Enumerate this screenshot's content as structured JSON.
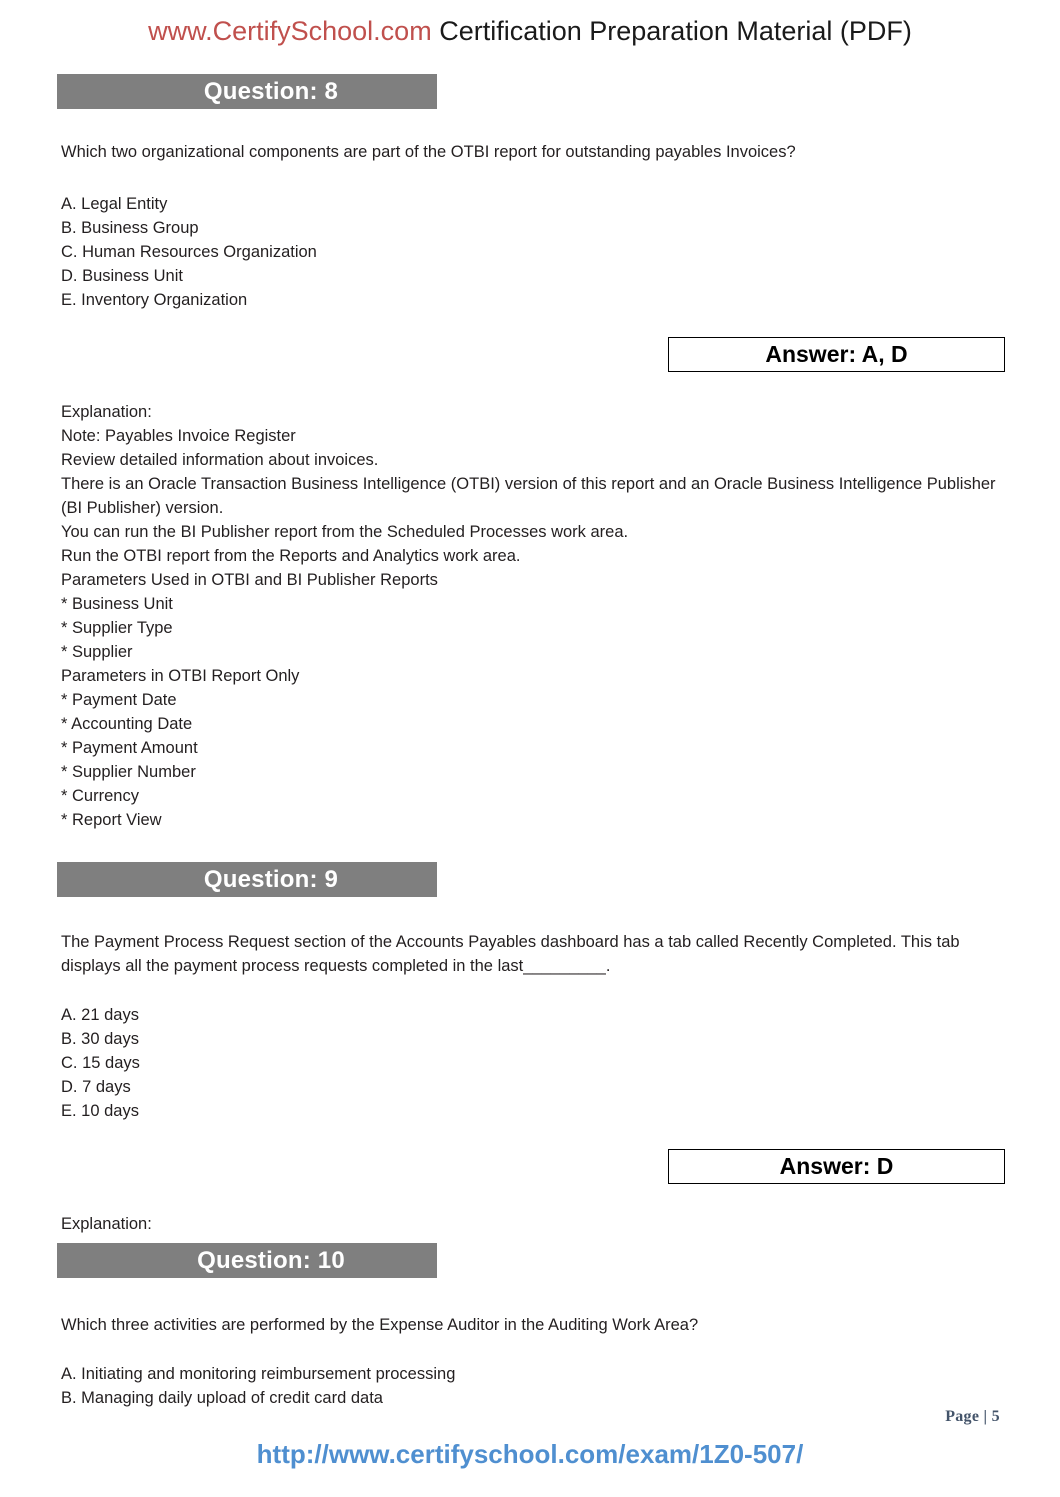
{
  "header": {
    "brand": "www.CertifySchool.com",
    "tagline": " Certification Preparation Material (PDF)"
  },
  "questions": [
    {
      "banner": "Question: 8",
      "stem": "Which two organizational components are part of the OTBI report for outstanding payables Invoices?",
      "options": [
        "A. Legal Entity",
        "B. Business Group",
        "C. Human Resources Organization",
        "D. Business Unit",
        "E. Inventory Organization"
      ],
      "answer": "Answer: A, D",
      "explanation_label": "Explanation:",
      "explanation_lines": [
        "Note: Payables Invoice Register",
        "Review detailed information about invoices.",
        "There is an Oracle Transaction Business Intelligence (OTBI) version of this report and an Oracle Business Intelligence Publisher (BI Publisher) version.",
        "You can run the BI Publisher report from the Scheduled Processes work area.",
        "Run the OTBI report from the Reports and Analytics work area.",
        "Parameters Used in OTBI and BI Publisher Reports",
        "* Business Unit",
        "* Supplier Type",
        "* Supplier",
        "Parameters in OTBI Report Only",
        "* Payment Date",
        "* Accounting Date",
        "* Payment Amount",
        "* Supplier Number",
        "* Currency",
        "* Report View"
      ]
    },
    {
      "banner": "Question: 9",
      "stem": "The Payment Process Request section of the Accounts Payables dashboard has a tab called Recently Completed. This tab displays all the payment process requests completed in the last_________.",
      "options": [
        "A. 21 days",
        "B. 30 days",
        "C. 15 days",
        "D. 7 days",
        "E. 10 days"
      ],
      "answer": "Answer: D",
      "explanation_label": "Explanation:",
      "explanation_lines": []
    },
    {
      "banner": "Question: 10",
      "stem": "Which three activities are performed by the Expense Auditor in the Auditing Work Area?",
      "options": [
        "A. Initiating and monitoring reimbursement processing",
        "B. Managing daily upload of credit card data"
      ]
    }
  ],
  "footer": {
    "page_number": "Page | 5",
    "url": "http://www.certifyschool.com/exam/1Z0-507/"
  }
}
